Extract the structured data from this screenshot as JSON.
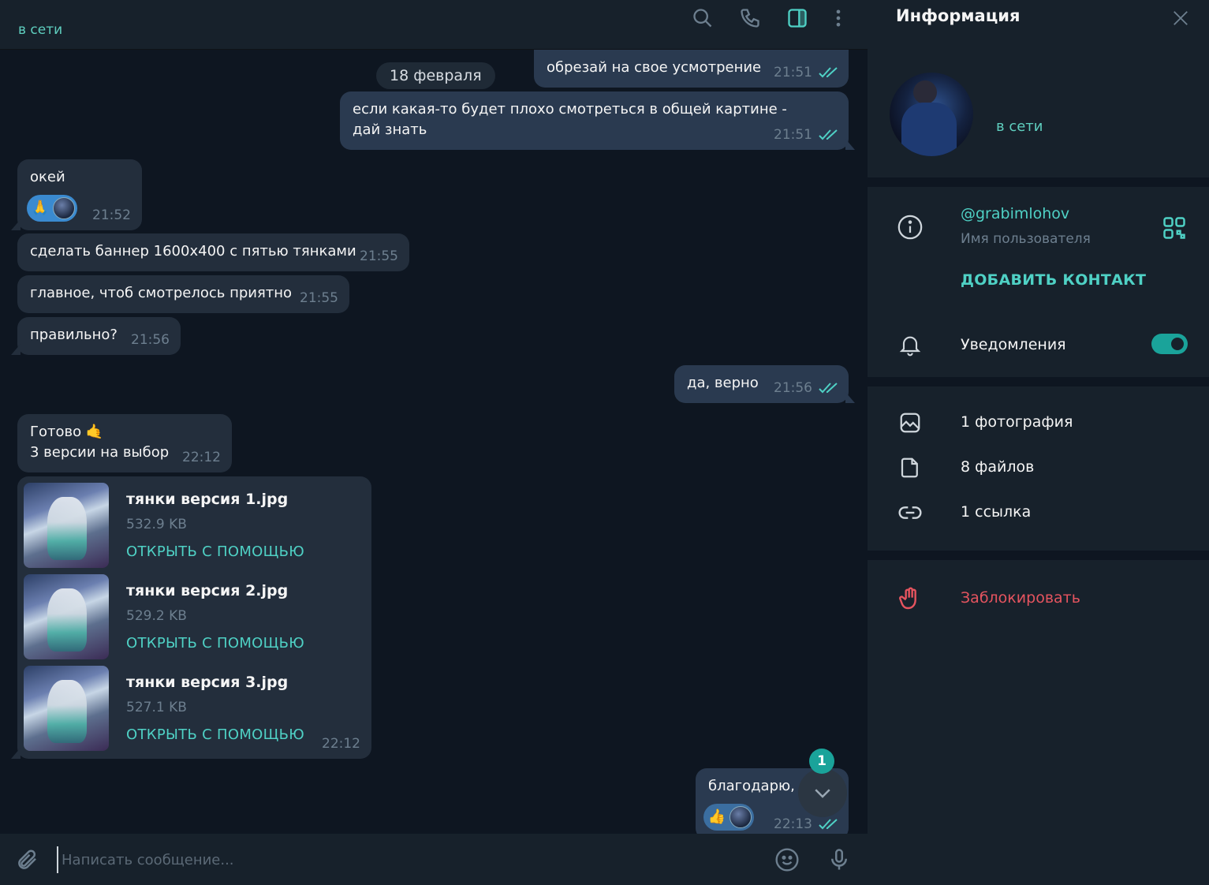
{
  "chat": {
    "header": {
      "status": "в сети"
    },
    "date_separator": "18 февраля",
    "messages": [
      {
        "id": "m1",
        "dir": "out",
        "text": "обрезай на свое усмотрение",
        "time": "21:51"
      },
      {
        "id": "m2",
        "dir": "out",
        "text": "если какая-то будет плохо смотреться в общей картине - дай знать",
        "time": "21:51"
      },
      {
        "id": "m3",
        "dir": "in",
        "text": "окей",
        "time": "21:52",
        "reaction": "🙏"
      },
      {
        "id": "m4",
        "dir": "in",
        "text": "сделать баннер 1600x400 с пятью тянками",
        "time": "21:55"
      },
      {
        "id": "m5",
        "dir": "in",
        "text": "главное, чтоб смотрелось приятно",
        "time": "21:55"
      },
      {
        "id": "m6",
        "dir": "in",
        "text": "правильно?",
        "time": "21:56"
      },
      {
        "id": "m7",
        "dir": "out",
        "text": "да, верно",
        "time": "21:56"
      },
      {
        "id": "m8",
        "dir": "in",
        "text_line1": "Готово 🤙",
        "text_line2": "3 версии на выбор",
        "time": "22:12"
      },
      {
        "id": "m10",
        "dir": "out",
        "text": "благодарю,",
        "time": "22:13",
        "reaction": "👍"
      }
    ],
    "files": {
      "time": "22:12",
      "open_label": "ОТКРЫТЬ С ПОМОЩЬЮ",
      "items": [
        {
          "name": "тянки версия 1.jpg",
          "size": "532.9 KB"
        },
        {
          "name": "тянки версия 2.jpg",
          "size": "529.2 KB"
        },
        {
          "name": "тянки версия 3.jpg",
          "size": "527.1 KB"
        }
      ]
    },
    "unread_count": "1",
    "composer": {
      "placeholder": "Написать сообщение..."
    }
  },
  "info": {
    "title": "Информация",
    "status": "в сети",
    "username": "@grabimlohov",
    "username_label": "Имя пользователя",
    "add_contact": "ДОБАВИТЬ КОНТАКТ",
    "notifications_label": "Уведомления",
    "notifications_on": true,
    "media": [
      {
        "label": "1 фотография",
        "icon": "photo-icon"
      },
      {
        "label": "8 файлов",
        "icon": "file-icon"
      },
      {
        "label": "1 ссылка",
        "icon": "link-icon"
      }
    ],
    "block_label": "Заблокировать"
  },
  "colors": {
    "accent": "#4fd1c5",
    "danger": "#e5545f",
    "chat_bg": "#0e1621",
    "panel_bg": "#17212b",
    "bubble_in": "#232e3c",
    "bubble_out": "#2a3a50"
  }
}
